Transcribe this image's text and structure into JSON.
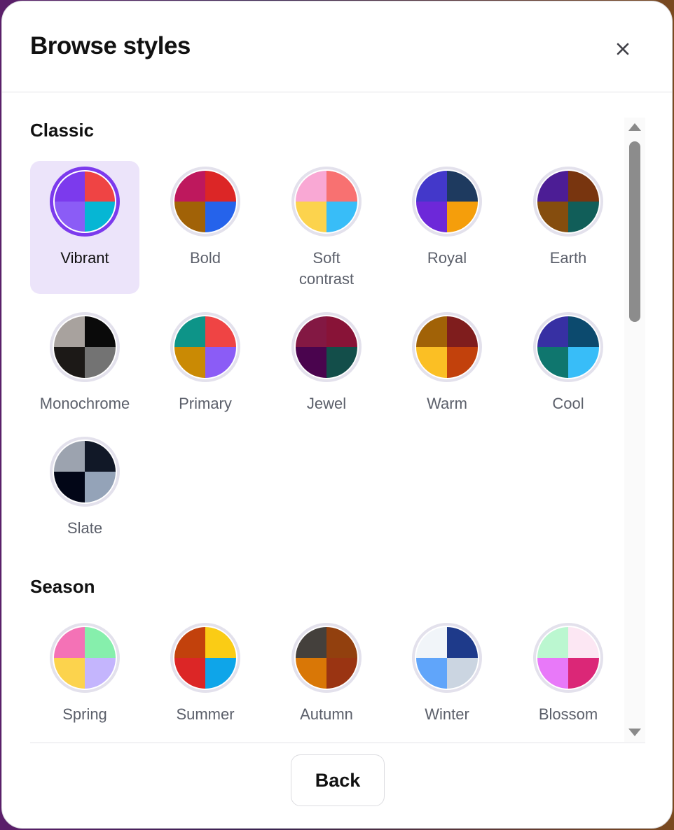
{
  "dialog": {
    "title": "Browse styles",
    "close_icon": "close-icon",
    "back_label": "Back"
  },
  "sections": [
    {
      "title": "Classic",
      "styles": [
        {
          "name": "Vibrant",
          "selected": true,
          "colors": [
            "#7c3aed",
            "#ef4444",
            "#8b5cf6",
            "#06b6d4"
          ]
        },
        {
          "name": "Bold",
          "selected": false,
          "colors": [
            "#be185d",
            "#dc2626",
            "#a16207",
            "#2563eb"
          ]
        },
        {
          "name": "Soft contrast",
          "selected": false,
          "colors": [
            "#f9a8d4",
            "#f87171",
            "#fcd34d",
            "#38bdf8"
          ]
        },
        {
          "name": "Royal",
          "selected": false,
          "colors": [
            "#4338ca",
            "#1e3a5f",
            "#6d28d9",
            "#f59e0b"
          ]
        },
        {
          "name": "Earth",
          "selected": false,
          "colors": [
            "#4c1d95",
            "#78350f",
            "#854d0e",
            "#115e59"
          ]
        },
        {
          "name": "Monochrome",
          "selected": false,
          "colors": [
            "#a8a29e",
            "#0a0a0a",
            "#1c1917",
            "#737373"
          ]
        },
        {
          "name": "Primary",
          "selected": false,
          "colors": [
            "#0d9488",
            "#ef4444",
            "#ca8a04",
            "#8b5cf6"
          ]
        },
        {
          "name": "Jewel",
          "selected": false,
          "colors": [
            "#831843",
            "#881337",
            "#4a044e",
            "#134e4a"
          ]
        },
        {
          "name": "Warm",
          "selected": false,
          "colors": [
            "#a16207",
            "#7f1d1d",
            "#fbbf24",
            "#c2410c"
          ]
        },
        {
          "name": "Cool",
          "selected": false,
          "colors": [
            "#3730a3",
            "#0c4a6e",
            "#0f766e",
            "#38bdf8"
          ]
        },
        {
          "name": "Slate",
          "selected": false,
          "colors": [
            "#9ca3af",
            "#111827",
            "#020617",
            "#94a3b8"
          ]
        }
      ]
    },
    {
      "title": "Season",
      "styles": [
        {
          "name": "Spring",
          "selected": false,
          "colors": [
            "#f472b6",
            "#86efac",
            "#fcd34d",
            "#c4b5fd"
          ]
        },
        {
          "name": "Summer",
          "selected": false,
          "colors": [
            "#c2410c",
            "#facc15",
            "#dc2626",
            "#0ea5e9"
          ]
        },
        {
          "name": "Autumn",
          "selected": false,
          "colors": [
            "#44403c",
            "#92400e",
            "#d97706",
            "#9a3412"
          ]
        },
        {
          "name": "Winter",
          "selected": false,
          "colors": [
            "#f1f5f9",
            "#1e3a8a",
            "#60a5fa",
            "#cbd5e1"
          ]
        },
        {
          "name": "Blossom",
          "selected": false,
          "colors": [
            "#bbf7d0",
            "#fce7f3",
            "#e879f9",
            "#db2777"
          ]
        }
      ]
    }
  ],
  "scrollbar": {
    "up_icon": "triangle-up-icon",
    "down_icon": "triangle-down-icon"
  }
}
